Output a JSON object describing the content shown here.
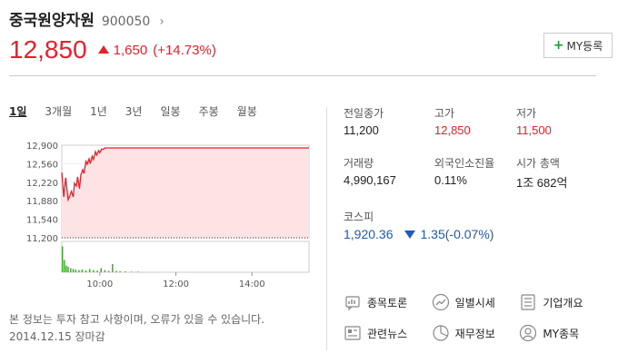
{
  "stock": {
    "name": "중국원양자원",
    "code": "900050",
    "chevron": "›",
    "price": "12,850",
    "change_amount": "1,650",
    "change_percent": "(+14.73%)"
  },
  "my_button": {
    "plus": "+",
    "label": "MY등록"
  },
  "tabs": [
    "1일",
    "3개월",
    "1년",
    "3년",
    "일봉",
    "주봉",
    "월봉"
  ],
  "chart_data": {
    "type": "line",
    "y_ticks": [
      "12,900",
      "12,560",
      "12,220",
      "11,880",
      "11,540",
      "11,200"
    ],
    "ylim": [
      11200,
      12900
    ],
    "x_ticks": [
      "10:00",
      "12:00",
      "14:00"
    ],
    "baseline": 11200,
    "x_minutes": [
      0,
      3,
      6,
      8,
      10,
      13,
      15,
      18,
      20,
      23,
      25,
      28,
      30,
      33,
      35,
      38,
      40,
      43,
      45,
      48,
      50,
      53,
      55,
      58,
      60,
      63,
      65,
      68,
      70,
      73,
      75,
      78,
      80,
      85,
      90,
      100,
      120,
      180,
      240,
      300,
      360,
      390
    ],
    "prices": [
      12400,
      11950,
      12300,
      12100,
      11900,
      11980,
      12050,
      11950,
      12200,
      12150,
      12320,
      12100,
      12350,
      12450,
      12380,
      12600,
      12550,
      12650,
      12560,
      12700,
      12640,
      12780,
      12720,
      12800,
      12760,
      12830,
      12820,
      12850,
      12850,
      12850,
      12850,
      12850,
      12850,
      12850,
      12850,
      12850,
      12850,
      12850,
      12850,
      12850,
      12850,
      12850
    ],
    "volume_x_minutes": [
      1,
      4,
      7,
      10,
      14,
      18,
      22,
      27,
      32,
      38,
      44,
      50,
      56,
      62,
      68,
      74,
      80,
      86,
      92,
      100,
      110,
      120
    ],
    "volume_rel": [
      0.95,
      0.45,
      0.25,
      0.2,
      0.15,
      0.12,
      0.1,
      0.08,
      0.1,
      0.07,
      0.12,
      0.08,
      0.06,
      0.15,
      0.08,
      0.05,
      0.3,
      0.05,
      0.04,
      0.03,
      0.02,
      0.02
    ]
  },
  "notice": {
    "line1": "본 정보는 투자 참고 사항이며, 오류가 있을 수 있습니다.",
    "line2": "2014.12.15 장마감"
  },
  "stats": {
    "prev_close_label": "전일종가",
    "prev_close": "11,200",
    "high_label": "고가",
    "high": "12,850",
    "low_label": "저가",
    "low": "11,500",
    "volume_label": "거래량",
    "volume": "4,990,167",
    "foreign_label": "외국인소진율",
    "foreign": "0.11%",
    "marketcap_label": "시가 총액",
    "marketcap": "1조 682억",
    "index_label": "코스피",
    "index_value": "1,920.36",
    "index_change": "1.35",
    "index_change_pct": "(-0.07%)"
  },
  "links": {
    "discussion": "종목토론",
    "daily": "일별시세",
    "company": "기업개요",
    "news": "관련뉴스",
    "finance": "재무정보",
    "my": "MY종목"
  },
  "colors": {
    "up": "#e8202b",
    "down": "#1f5ab8",
    "fill": "#fde3e3",
    "volume": "#3fae2a"
  }
}
